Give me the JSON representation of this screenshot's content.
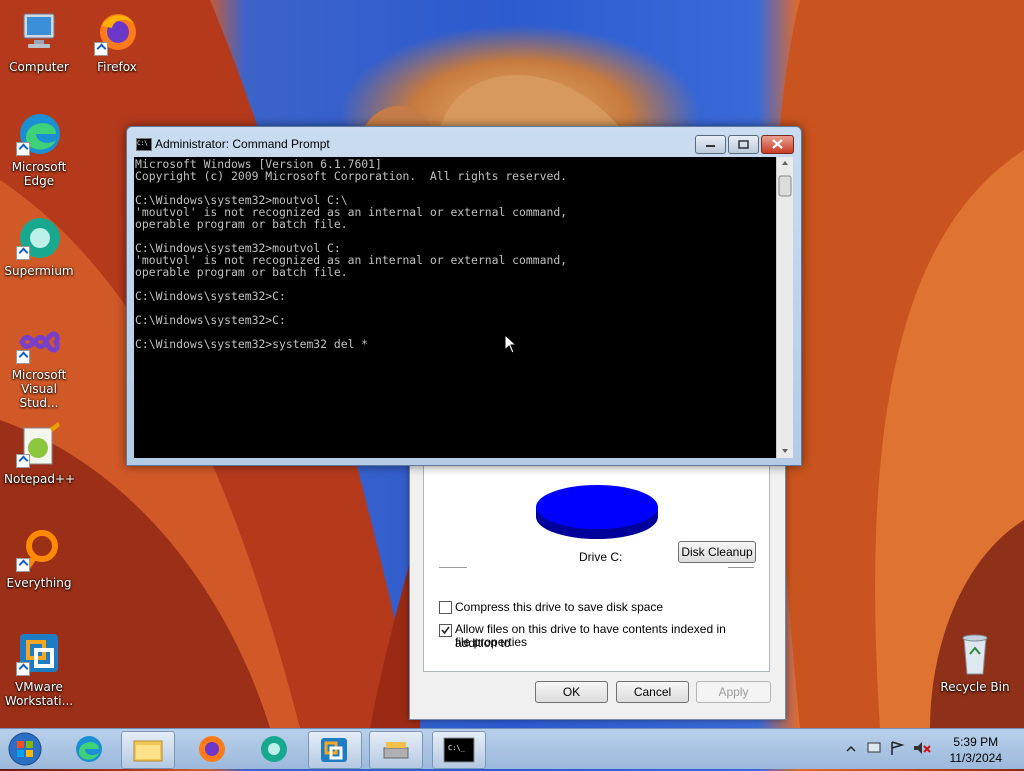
{
  "desktop_icons": [
    {
      "label": "Computer",
      "icon": "computer-icon"
    },
    {
      "label": "Firefox",
      "icon": "firefox-icon"
    },
    {
      "label": "Microsoft Edge",
      "icon": "edge-icon"
    },
    {
      "label": "Supermium",
      "icon": "supermium-icon"
    },
    {
      "label": "Microsoft Visual Stud...",
      "icon": "visual-studio-icon"
    },
    {
      "label": "Notepad++",
      "icon": "notepadpp-icon"
    },
    {
      "label": "Everything",
      "icon": "everything-icon"
    },
    {
      "label": "VMware Workstati...",
      "icon": "vmware-icon"
    },
    {
      "label": "Recycle Bin",
      "icon": "recycle-bin-icon"
    }
  ],
  "cmd": {
    "title": "Administrator: Command Prompt",
    "console_text": "Microsoft Windows [Version 6.1.7601]\nCopyright (c) 2009 Microsoft Corporation.  All rights reserved.\n\nC:\\Windows\\system32>moutvol C:\\\n'moutvol' is not recognized as an internal or external command,\noperable program or batch file.\n\nC:\\Windows\\system32>moutvol C:\n'moutvol' is not recognized as an internal or external command,\noperable program or batch file.\n\nC:\\Windows\\system32>C:\n\nC:\\Windows\\system32>C:\n\nC:\\Windows\\system32>system32 del *"
  },
  "properties": {
    "drive_label": "Drive C:",
    "disk_cleanup": "Disk Cleanup",
    "compress_label": "Compress this drive to save disk space",
    "compress_checked": false,
    "index_label_1": "Allow files on this drive to have contents indexed in addition to",
    "index_label_2": "file properties",
    "index_checked": true,
    "ok": "OK",
    "cancel": "Cancel",
    "apply": "Apply",
    "pie_color": "#0000ff"
  },
  "taskbar": {
    "items": [
      "start-button",
      "edge-icon",
      "explorer-icon",
      "firefox-icon",
      "supermium-icon",
      "vmware-icon",
      "disk-props-icon",
      "cmd-icon"
    ],
    "time": "5:39 PM",
    "date": "11/3/2024"
  }
}
